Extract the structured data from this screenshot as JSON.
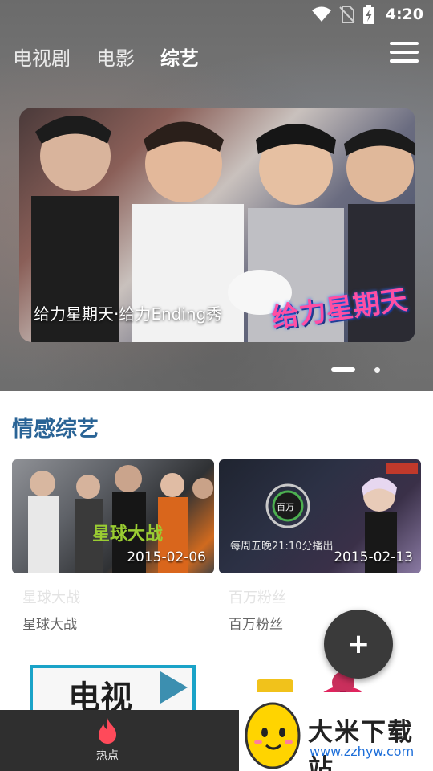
{
  "status_bar": {
    "time": "4:20",
    "icons": [
      "wifi-icon",
      "no-sim-icon",
      "battery-charging-icon"
    ]
  },
  "top_nav": {
    "tabs": [
      {
        "label": "电视剧",
        "active": false
      },
      {
        "label": "电影",
        "active": false
      },
      {
        "label": "综艺",
        "active": true
      }
    ],
    "menu_icon": "hamburger-menu-icon"
  },
  "banner": {
    "caption": "给力星期天·给力Ending秀",
    "logo_text": "给力星期天",
    "page_count": 2,
    "current_page": 1
  },
  "section": {
    "title": "情感综艺",
    "cards": [
      {
        "date": "2015-02-06",
        "title": "星球大战",
        "subtitle": "星球大战"
      },
      {
        "date": "2015-02-13",
        "title": "百万粉丝",
        "subtitle": "百万粉丝"
      }
    ]
  },
  "fab": {
    "icon": "plus-icon",
    "label": "+"
  },
  "peek": {
    "left_text": "电视"
  },
  "bottom_bar": {
    "tabs": [
      {
        "label": "热点",
        "icon": "flame-icon",
        "color": "#ff4a5a"
      }
    ]
  },
  "watermark": {
    "title": "大米下载站",
    "url": "www.zzhyw.com"
  }
}
